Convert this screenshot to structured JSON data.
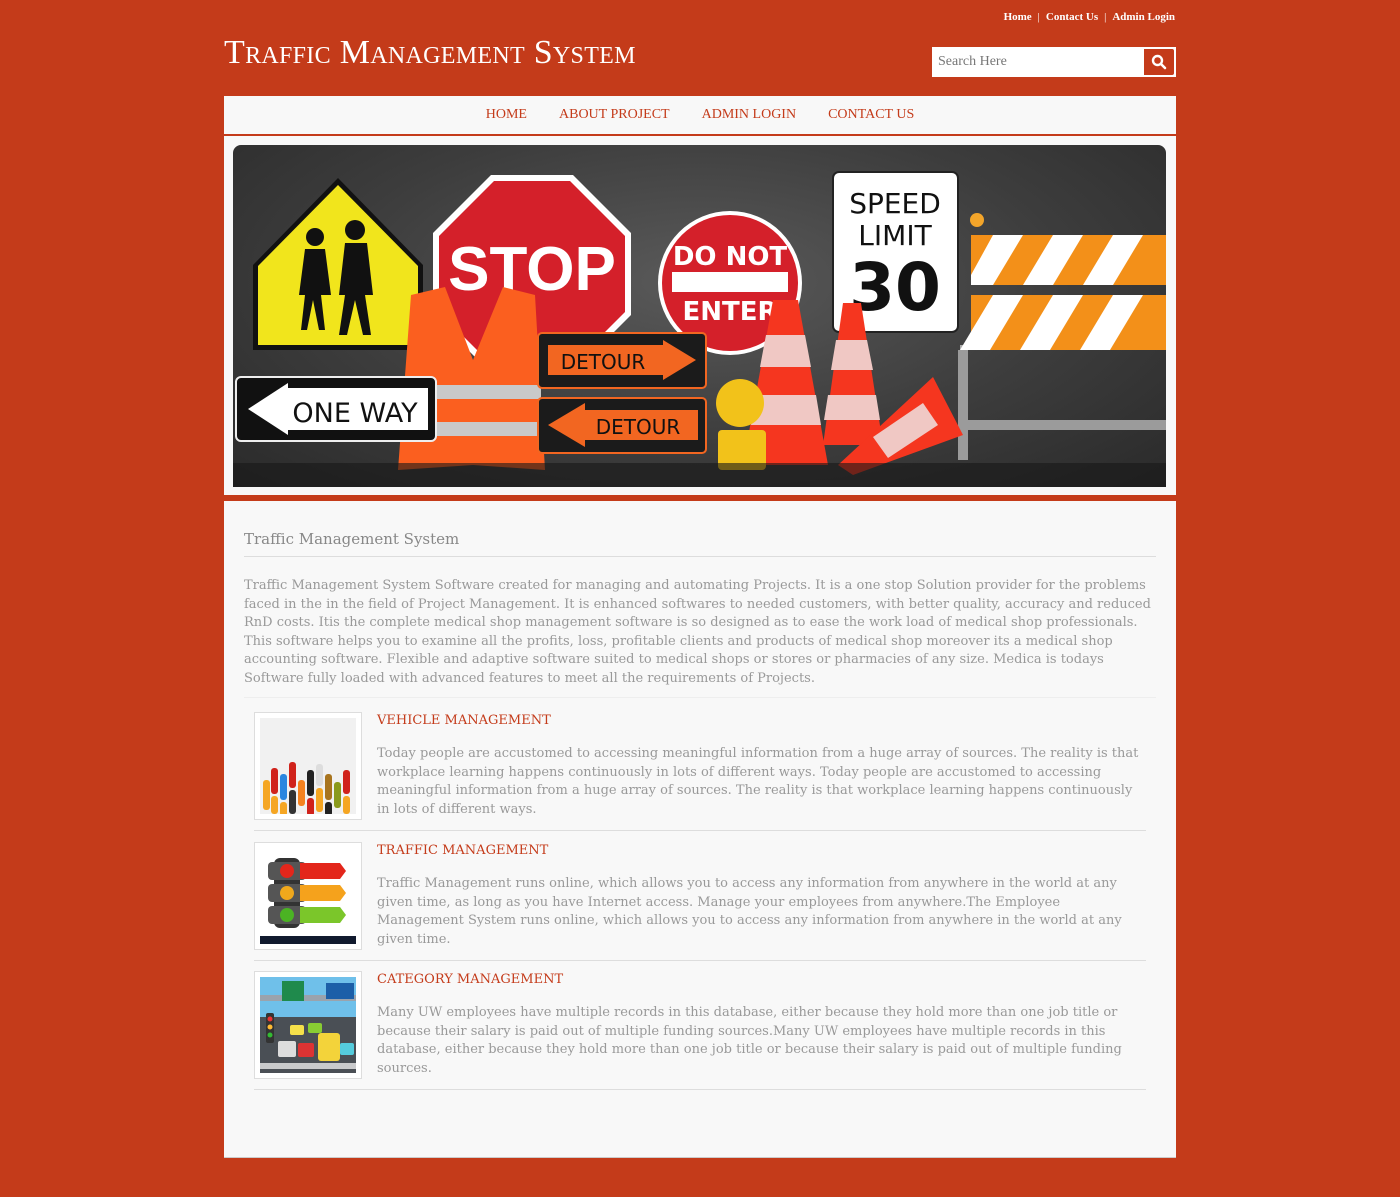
{
  "top_links": [
    "Home",
    "Contact Us",
    "Admin Login"
  ],
  "site_title": "Traffic Management System",
  "search": {
    "placeholder": "Search Here",
    "icon": "search-icon"
  },
  "nav": [
    "HOME",
    "ABOUT PROJECT",
    "ADMIN LOGIN",
    "CONTACT US"
  ],
  "banner": {
    "description": "Traffic signs collage",
    "signs": [
      "ONE WAY",
      "STOP",
      "DO NOT",
      "ENTER",
      "DETOUR",
      "DETOUR",
      "SPEED",
      "LIMIT",
      "30"
    ]
  },
  "main": {
    "heading": "Traffic Management System",
    "intro": "Traffic Management System Software created for managing and automating Projects. It is a one stop Solution provider for the problems faced in the in the field of Project Management. It is enhanced softwares to needed customers, with better quality, accuracy and reduced RnD costs. Itis the complete medical shop management software is so designed as to ease the work load of medical shop professionals. This software helps you to examine all the profits, loss, profitable clients and products of medical shop moreover its a medical shop accounting software. Flexible and adaptive software suited to medical shops or stores or pharmacies of any size. Medica is todays Software fully loaded with advanced features to meet all the requirements of Projects.",
    "features": [
      {
        "title": "VEHICLE MANAGEMENT",
        "image": "cars-top-view",
        "text": "Today people are accustomed to accessing meaningful information from a huge array of sources. The reality is that workplace learning happens continuously in lots of different ways. Today people are accustomed to accessing meaningful information from a huge array of sources. The reality is that workplace learning happens continuously in lots of different ways."
      },
      {
        "title": "TRAFFIC MANAGEMENT",
        "image": "traffic-light-infographic",
        "text": "Traffic Management runs online, which allows you to access any information from anywhere in the world at any given time, as long as you have Internet access. Manage your employees from anywhere.The Employee Management System runs online, which allows you to access any information from anywhere in the world at any given time."
      },
      {
        "title": "CATEGORY MANAGEMENT",
        "image": "city-traffic-illustration",
        "text": "Many UW employees have multiple records in this database, either because they hold more than one job title or because their salary is paid out of multiple funding sources.Many UW employees have multiple records in this database, either because they hold more than one job title or because their salary is paid out of multiple funding sources."
      }
    ]
  },
  "colors": {
    "brand": "#c43b1a",
    "panel": "#f8f8f8",
    "muted_text": "#999999"
  }
}
